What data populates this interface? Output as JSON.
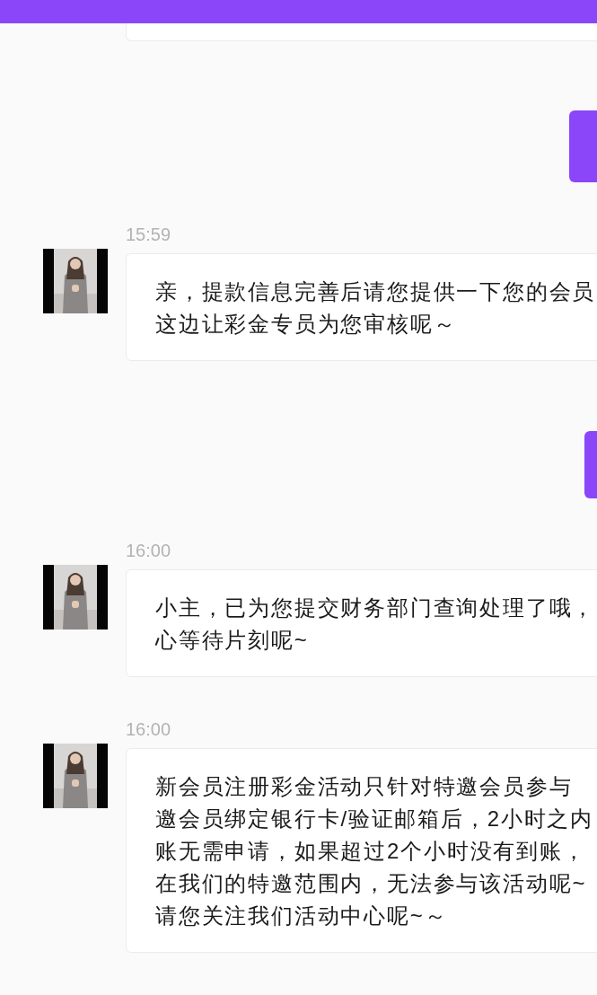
{
  "messages": [
    {
      "kind": "partial"
    },
    {
      "kind": "sent"
    },
    {
      "kind": "received",
      "time": "15:59",
      "avatar": {
        "kind": "picture"
      },
      "lines": [
        "亲，提款信息完善后请您提供一下您的会员",
        "这边让彩金专员为您审核呢～"
      ]
    },
    {
      "kind": "sent"
    },
    {
      "kind": "received",
      "time": "16:00",
      "avatar": {
        "kind": "picture"
      },
      "lines": [
        "小主，已为您提交财务部门查询处理了哦，",
        "心等待片刻呢~"
      ]
    },
    {
      "kind": "received",
      "time": "16:00",
      "avatar": {
        "kind": "picture"
      },
      "lines": [
        "新会员注册彩金活动只针对特邀会员参与",
        "邀会员绑定银行卡/验证邮箱后，2小时之内",
        "账无需申请，如果超过2个小时没有到账，",
        "在我们的特邀范围内，无法参与该活动呢~",
        "请您关注我们活动中心呢~～"
      ]
    }
  ]
}
